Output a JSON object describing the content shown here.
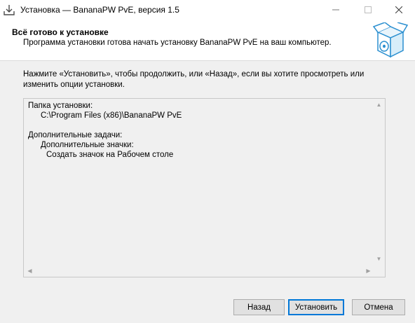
{
  "window": {
    "title": "Установка — BananaPW PvE, версия 1.5",
    "icons": {
      "app": "installer-download-icon",
      "minimize": "minimize-icon",
      "maximize": "maximize-icon",
      "close": "close-icon"
    }
  },
  "header": {
    "title": "Всё готово к установке",
    "subtitle": "Программа установки готова начать установку BananaPW PvE на ваш компьютер.",
    "icon": "setup-box-icon"
  },
  "body": {
    "intro": "Нажмите «Установить», чтобы продолжить, или «Назад», если вы хотите просмотреть или изменить опции установки.",
    "memo": {
      "folder_label": "Папка установки:",
      "folder_path": "C:\\Program Files (x86)\\BananaPW PvE",
      "tasks_label": "Дополнительные задачи:",
      "icons_label": "Дополнительные значки:",
      "desktop_icon": "Создать значок на Рабочем столе"
    }
  },
  "footer": {
    "back_label": "Назад",
    "install_label": "Установить",
    "cancel_label": "Отмена"
  },
  "colors": {
    "accent": "#0078d7",
    "panel": "#f0f0f0",
    "button": "#e1e1e1"
  }
}
